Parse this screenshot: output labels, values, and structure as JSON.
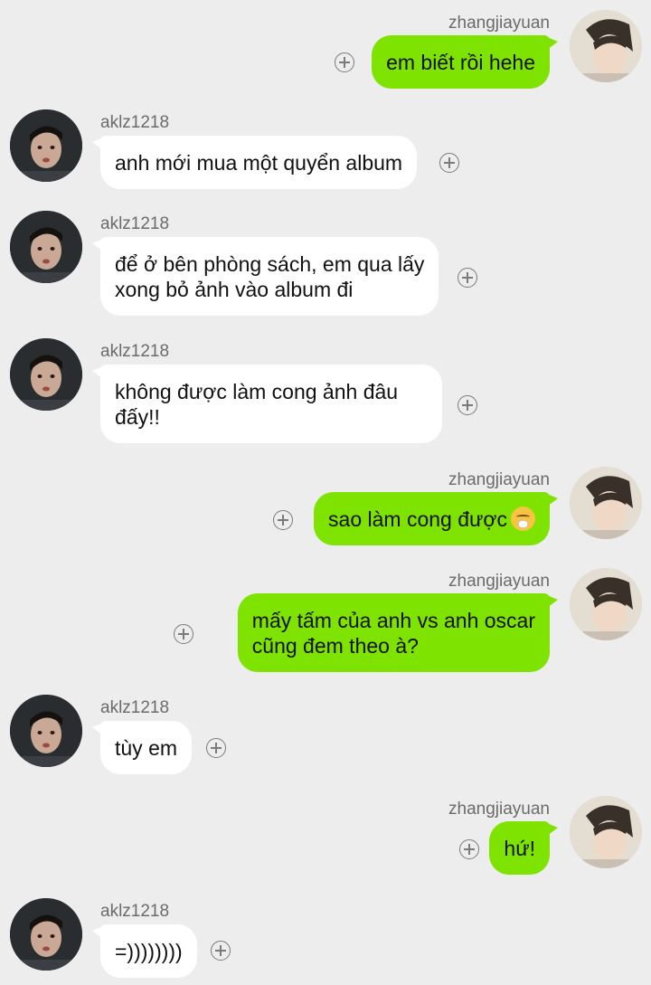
{
  "messages": [
    {
      "side": "right",
      "sender": "zhangjiayuan",
      "text": "em biết rồi hehe"
    },
    {
      "side": "left",
      "sender": "aklz1218",
      "text": "anh mới mua một quyển album"
    },
    {
      "side": "left",
      "sender": "aklz1218",
      "text": "để ở bên phòng sách, em qua lấy\nxong bỏ ảnh vào album đi"
    },
    {
      "side": "left",
      "sender": "aklz1218",
      "text": "không được làm cong ảnh đâu\nđấy!!"
    },
    {
      "side": "right",
      "sender": "zhangjiayuan",
      "text": "sao làm cong được",
      "emoji": "huffing-face-emoji"
    },
    {
      "side": "right",
      "sender": "zhangjiayuan",
      "text": "mấy tấm của anh vs anh oscar\ncũng đem theo à?"
    },
    {
      "side": "left",
      "sender": "aklz1218",
      "text": "tùy em"
    },
    {
      "side": "right",
      "sender": "zhangjiayuan",
      "text": "hứ!"
    },
    {
      "side": "left",
      "sender": "aklz1218",
      "text": "=))))))))"
    }
  ],
  "icons": {
    "add": "plus-circle-icon",
    "avatar_right": "avatar-zhangjiayuan",
    "avatar_left": "avatar-aklz1218"
  },
  "colors": {
    "background": "#ededed",
    "sent_bubble": "#7ee300",
    "received_bubble": "#ffffff",
    "username": "#6b6b6b"
  }
}
